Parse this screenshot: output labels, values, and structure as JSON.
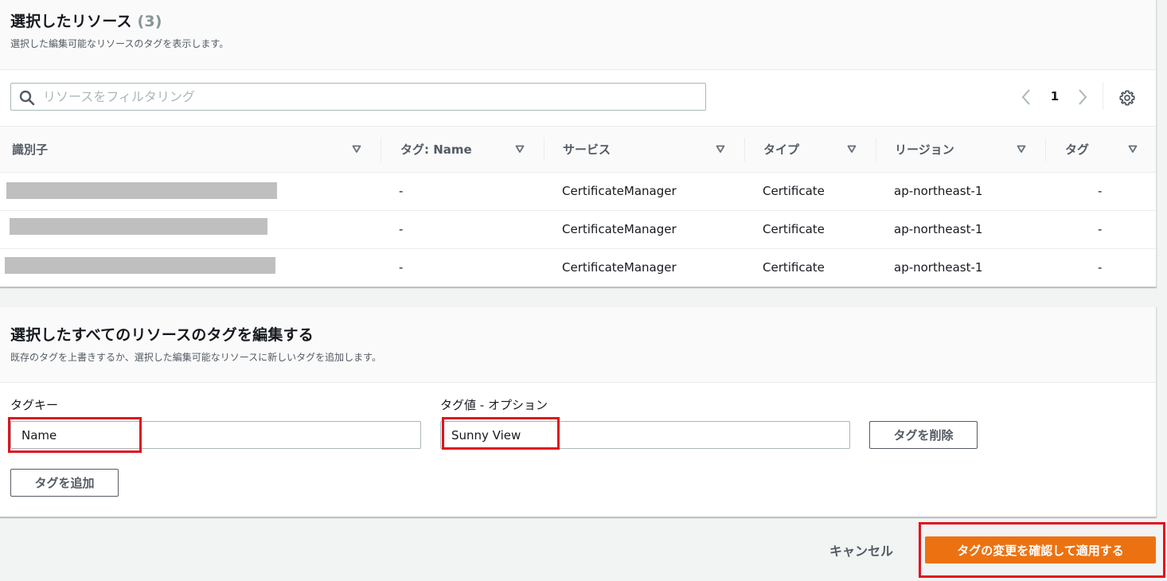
{
  "resources": {
    "title": "選択したリソース",
    "count": "(3)",
    "description": "選択した編集可能なリソースのタグを表示します。",
    "filter_placeholder": "リソースをフィルタリング",
    "page": "1",
    "columns": [
      "識別子",
      "タグ: Name",
      "サービス",
      "タイプ",
      "リージョン",
      "タグ"
    ],
    "rows": [
      {
        "tag_name": "-",
        "service": "CertificateManager",
        "type": "Certificate",
        "region": "ap-northeast-1",
        "tags": "-"
      },
      {
        "tag_name": "-",
        "service": "CertificateManager",
        "type": "Certificate",
        "region": "ap-northeast-1",
        "tags": "-"
      },
      {
        "tag_name": "-",
        "service": "CertificateManager",
        "type": "Certificate",
        "region": "ap-northeast-1",
        "tags": "-"
      }
    ]
  },
  "tag_edit": {
    "title": "選択したすべてのリソースのタグを編集する",
    "description": "既存のタグを上書きするか、選択した編集可能なリソースに新しいタグを追加します。",
    "key_label": "タグキー",
    "value_label": "タグ値 - オプション",
    "key_value": "Name",
    "value_value": "Sunny View",
    "remove_label": "タグを削除",
    "add_label": "タグを追加"
  },
  "footer": {
    "cancel_label": "キャンセル",
    "apply_label": "タグの変更を確認して適用する"
  },
  "colors": {
    "primary_button": "#ec7211",
    "highlight_box": "#e0121f",
    "redaction": "#bfbfbf"
  }
}
